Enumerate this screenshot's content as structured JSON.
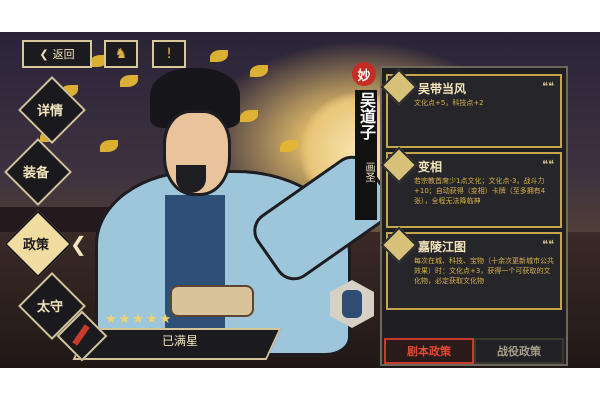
{
  "top_bar": {
    "back_label": "返回",
    "icons": [
      "character-icon",
      "info-icon"
    ]
  },
  "nav": [
    {
      "label": "详情",
      "active": false
    },
    {
      "label": "装备",
      "active": false
    },
    {
      "label": "政策",
      "active": true
    },
    {
      "label": "太守",
      "active": false
    }
  ],
  "character": {
    "badge": "妙",
    "name": "吴道子",
    "title": "画圣",
    "stars": "★★★★★",
    "star_status": "已满星"
  },
  "policies": [
    {
      "name": "吴带当风",
      "desc": "文化点+5，科技点+2"
    },
    {
      "name": "变相",
      "desc": "若宗教首席少1点文化；文化点-3，战斗力+10；自动获得（变相）卡牌（至多拥有4张），全程无法降临神"
    },
    {
      "name": "嘉陵江图",
      "desc": "每次在城、科技、宝物（十余次更新城市公共效果）时：文化点+3，获得一个可获取的文化物，必定获取文化物"
    }
  ],
  "tabs": {
    "active": "剧本政策",
    "inactive": "战役政策"
  },
  "colors": {
    "accent_red": "#c83a2a",
    "gold": "#c7a54f",
    "dark": "#1f1e22"
  }
}
